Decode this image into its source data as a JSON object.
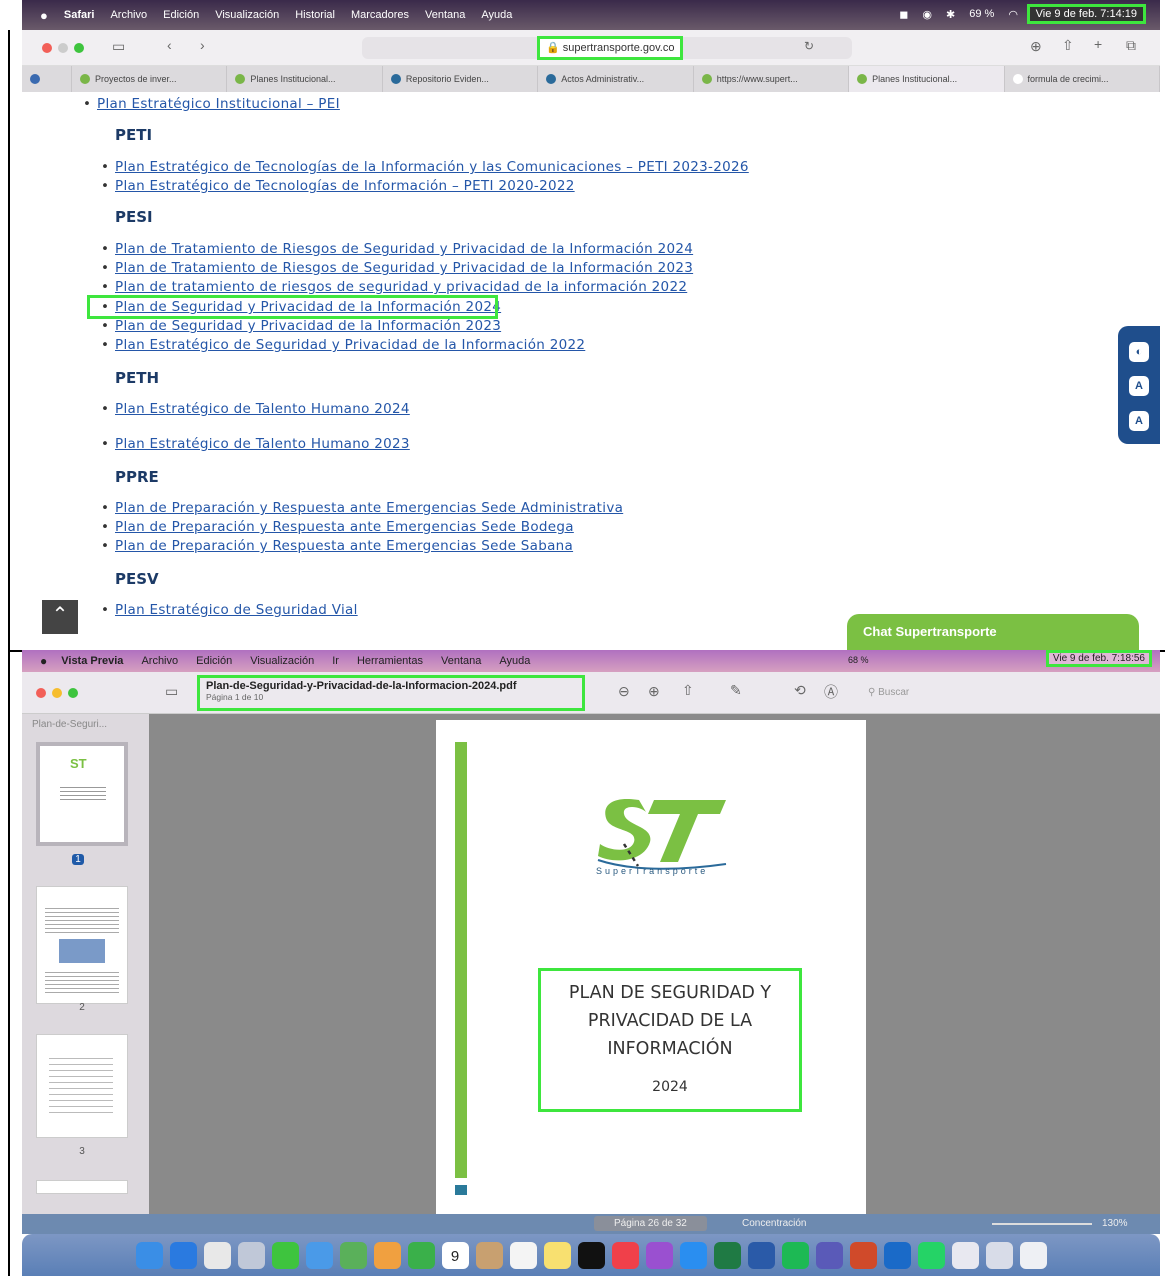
{
  "top": {
    "menubar": {
      "app": "Safari",
      "items": [
        "Archivo",
        "Edición",
        "Visualización",
        "Historial",
        "Marcadores",
        "Ventana",
        "Ayuda"
      ],
      "battery": "69 %",
      "clock": "Vie 9 de feb. 7:14:19"
    },
    "url": "supertransporte.gov.co",
    "tabs": [
      "Proyectos de inver...",
      "Planes Institucional...",
      "Repositorio Eviden...",
      "Actos Administrativ...",
      "https://www.supert...",
      "Planes Institucional...",
      "formula de crecimi..."
    ],
    "content": {
      "pei_link": "Plan Estratégico Institucional – PEI",
      "peti_heading": "PETI",
      "peti_links": [
        "Plan Estratégico de Tecnologías de la Información y las Comunicaciones – PETI 2023-2026",
        "Plan Estratégico de Tecnologías de Información – PETI 2020-2022"
      ],
      "pesi_heading": "PESI",
      "pesi_links": [
        "Plan de Tratamiento de Riesgos de Seguridad y Privacidad de la Información 2024",
        "Plan de Tratamiento de Riesgos de Seguridad y Privacidad de la Información 2023",
        "Plan de tratamiento de riesgos de seguridad y privacidad de la información 2022",
        "Plan de Seguridad y Privacidad de la Información 2024",
        "Plan de Seguridad y Privacidad de la Información 2023",
        "Plan Estratégico de Seguridad y Privacidad de la Información 2022"
      ],
      "peth_heading": "PETH",
      "peth_links": [
        "Plan Estratégico de Talento Humano 2024",
        "Plan Estratégico de Talento Humano 2023"
      ],
      "ppre_heading": "PPRE",
      "ppre_links": [
        "Plan de Preparación y Respuesta ante Emergencias Sede Administrativa",
        "Plan de Preparación y Respuesta ante Emergencias Sede Bodega",
        "Plan de Preparación y Respuesta ante Emergencias Sede Sabana"
      ],
      "pesv_heading": "PESV",
      "pesv_links": [
        "Plan Estratégico de Seguridad Vial"
      ]
    },
    "chat_label": "Chat Supertransporte"
  },
  "bottom": {
    "menubar": {
      "app": "Vista Previa",
      "items": [
        "Archivo",
        "Edición",
        "Visualización",
        "Ir",
        "Herramientas",
        "Ventana",
        "Ayuda"
      ],
      "battery": "68 %",
      "clock": "Vie 9 de feb. 7:18:56"
    },
    "filename": "Plan-de-Seguridad-y-Privacidad-de-la-Informacion-2024.pdf",
    "page_info": "Página 1 de 10",
    "search_placeholder": "Buscar",
    "sidebar_title": "Plan-de-Seguri...",
    "thumb_numbers": [
      "1",
      "2",
      "3"
    ],
    "doc": {
      "logo_text": "SuperTransporte",
      "title_lines": [
        "PLAN DE SEGURIDAD Y",
        "PRIVACIDAD DE LA",
        "INFORMACIÓN"
      ],
      "year": "2024"
    },
    "status": {
      "page": "Página 26 de 32",
      "mode": "Concentración",
      "zoom": "130%"
    },
    "dock_calendar_day": "9"
  },
  "colors": {
    "highlight": "#3ee63e",
    "link": "#2456a8",
    "brand_green": "#7bc043",
    "brand_blue": "#1f4e8c"
  }
}
